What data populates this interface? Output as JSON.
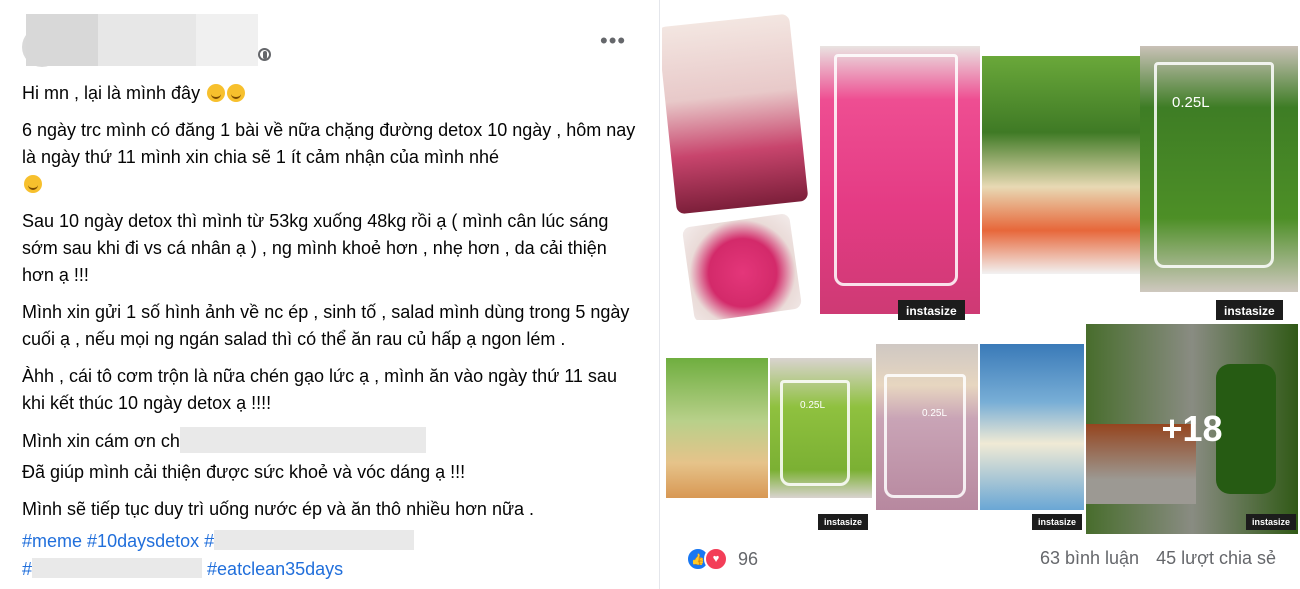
{
  "post": {
    "paragraphs": {
      "p1": "Hi mn , lại là mình đây",
      "p2": "6 ngày trc mình có đăng 1 bài về nữa chặng đường detox 10 ngày , hôm nay là ngày thứ 11 mình xin chia sẽ 1 ít cảm nhận của mình nhé",
      "p3": "Sau 10 ngày detox thì mình từ 53kg xuống 48kg rồi ạ ( mình cân lúc sáng sớm sau khi đi vs cá nhân ạ ) , ng mình khoẻ hơn , nhẹ hơn , da cải thiện hơn ạ !!!",
      "p4": "Mình xin gửi 1 số hình ảnh về nc ép , sinh tố , salad mình dùng trong 5 ngày cuối ạ , nếu mọi ng ngán salad thì có thể ăn rau củ hấp ạ ngon lém .",
      "p5": "Àhh , cái tô cơm trộn là nữa chén gạo lức ạ , mình ăn vào ngày thứ 11 sau khi kết thúc 10 ngày detox ạ !!!!",
      "p6a": "Mình xin cám ơn ch",
      "p6b": "Đã giúp mình cải thiện được sức khoẻ và vóc dáng ạ !!!",
      "p7": "Mình sẽ tiếp tục duy trì uống nước ép và ăn thô nhiều hơn nữa ."
    },
    "hashtags": {
      "line1_a": "#meme",
      "line1_b": "#10daysdetox",
      "line1_c": "#",
      "line2_a": "#",
      "line2_b": "#eatclean35days"
    }
  },
  "media": {
    "watermark": "instasize",
    "glass_label": "0.25L",
    "more_count": "+18"
  },
  "footer": {
    "reaction_count": "96",
    "comments": "63 bình luận",
    "shares": "45 lượt chia sẻ"
  }
}
